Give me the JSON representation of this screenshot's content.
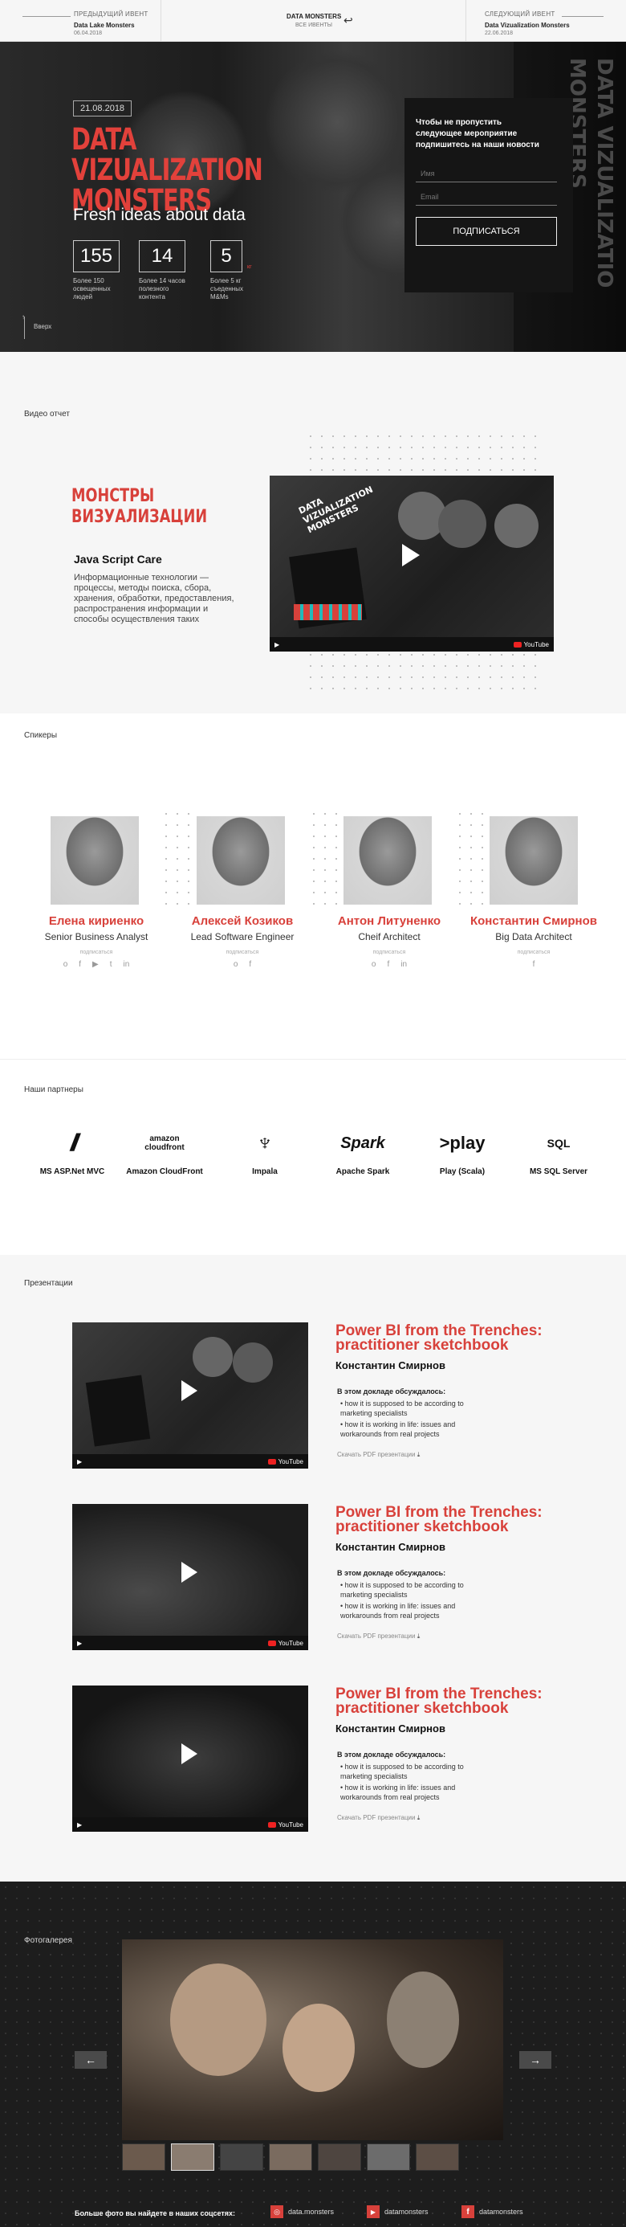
{
  "topbar": {
    "prev": {
      "label": "ПРЕДЫДУЩИЙ ИВЕНТ",
      "name": "Data Lake Monsters",
      "date": "06.04.2018"
    },
    "center": {
      "name": "DATA MONSTERS",
      "sub": "ВСЕ ИВЕНТЫ"
    },
    "next": {
      "label": "СЛЕДУЮЩИЙ ИВЕНТ",
      "name": "Data Vizualization Monsters",
      "date": "22.06.2018"
    }
  },
  "hero": {
    "date": "21.08.2018",
    "title_line1": "DATA VIZUALIZATION",
    "title_line2": "MONSTERS",
    "subtitle": "Fresh ideas about data",
    "stats": [
      {
        "value": "155",
        "text": "Более 150 освещенных людей"
      },
      {
        "value": "14",
        "text": "Более 14 часов полезного контента"
      },
      {
        "value": "5",
        "suffix": "кг",
        "text": "Более 5 кг съеденных M&Ms"
      }
    ],
    "up_label": "Вверх",
    "bg_text": "DATA VIZUALIZATIO MONSTERS",
    "subscribe": {
      "heading": "Чтобы не пропустить следующее мероприятие подпишитесь на наши новости",
      "name_placeholder": "Имя",
      "email_placeholder": "Email",
      "button": "ПОДПИСАТЬСЯ"
    }
  },
  "video_report": {
    "section_label": "Видео отчет",
    "title_line1": "МОНСТРЫ",
    "title_line2": "ВИЗУАЛИЗАЦИИ",
    "subtitle": "Java Script Care",
    "text": "Информационные технологии — процессы, методы поиска, сбора, хранения, обработки, предоставления, распространения информации и способы осуществления таких процессов и ме-",
    "video_overlay": "DATA VIZUALIZATION MONSTERS",
    "youtube": "YouTube"
  },
  "speakers": {
    "section_label": "Спикеры",
    "follow_label": "подписаться",
    "items": [
      {
        "name": "Елена кириенко",
        "role": "Senior Business Analyst",
        "socials": [
          "o",
          "f",
          "▶",
          "t",
          "in"
        ]
      },
      {
        "name": "Алексей Козиков",
        "role": "Lead Software Engineer",
        "socials": [
          "o",
          "f"
        ]
      },
      {
        "name": "Антон Литуненко",
        "role": "Cheif Architect",
        "socials": [
          "o",
          "f",
          "in"
        ]
      },
      {
        "name": "Константин Смирнов",
        "role": "Big Data Architect",
        "socials": [
          "f"
        ]
      }
    ]
  },
  "partners": {
    "section_label": "Наши партнеры",
    "items": [
      {
        "name": "MS ASP.Net MVC",
        "logo": "//"
      },
      {
        "name": "Amazon CloudFront",
        "logo": "amazon cloudfront"
      },
      {
        "name": "Impala",
        "logo": "♆"
      },
      {
        "name": "Apache Spark",
        "logo": "Spark"
      },
      {
        "name": "Play (Scala)",
        "logo": ">play"
      },
      {
        "name": "MS SQL Server",
        "logo": "SQL"
      }
    ]
  },
  "presentations": {
    "section_label": "Презентации",
    "items": [
      {
        "title": "Power BI from the Trenches: practitioner sketchbook",
        "author": "Константин Смирнов",
        "sub": "В этом докладе обсуждалось:",
        "points": [
          "how it is supposed to be according to marketing specialists",
          "how it is working in life: issues and workarounds from real projects"
        ],
        "download": "Скачать PDF презентации",
        "youtube": "YouTube"
      },
      {
        "title": "Power BI from the Trenches: practitioner sketchbook",
        "author": "Константин Смирнов",
        "sub": "В этом докладе обсуждалось:",
        "points": [
          "how it is supposed to be according to marketing specialists",
          "how it is working in life: issues and workarounds from real projects"
        ],
        "download": "Скачать PDF презентации",
        "youtube": "YouTube"
      },
      {
        "title": "Power BI from the Trenches: practitioner sketchbook",
        "author": "Константин Смирнов",
        "sub": "В этом докладе обсуждалось:",
        "points": [
          "how it is supposed to be according to marketing specialists",
          "how it is working in life: issues and workarounds from real projects"
        ],
        "download": "Скачать PDF презентации",
        "youtube": "YouTube"
      }
    ]
  },
  "gallery": {
    "section_label": "Фотогалерея",
    "prev": "←",
    "next": "→",
    "footer_text": "Больше фото вы найдете в наших соцсетях:",
    "socials": [
      {
        "icon": "instagram-icon",
        "handle": "data.monsters"
      },
      {
        "icon": "youtube-icon",
        "handle": "datamonsters"
      },
      {
        "icon": "facebook-icon",
        "handle": "datamonsters"
      }
    ]
  },
  "colors": {
    "accent": "#d8413b",
    "dark": "#1d1d1d",
    "light_bg": "#f6f6f6"
  }
}
